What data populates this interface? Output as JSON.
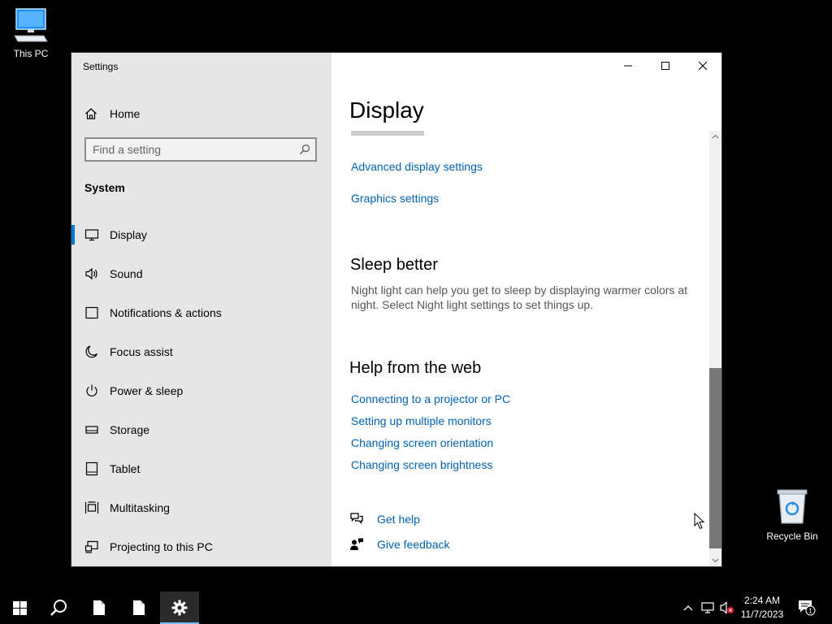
{
  "desktop": {
    "this_pc_label": "This PC",
    "recycle_bin_label": "Recycle Bin"
  },
  "window": {
    "title": "Settings",
    "home_label": "Home",
    "search_placeholder": "Find a setting",
    "section_label": "System",
    "nav_items": [
      {
        "label": "Display",
        "icon": "monitor-icon",
        "active": true
      },
      {
        "label": "Sound",
        "icon": "speaker-icon"
      },
      {
        "label": "Notifications & actions",
        "icon": "notification-icon"
      },
      {
        "label": "Focus assist",
        "icon": "moon-icon"
      },
      {
        "label": "Power & sleep",
        "icon": "power-icon"
      },
      {
        "label": "Storage",
        "icon": "storage-icon"
      },
      {
        "label": "Tablet",
        "icon": "tablet-icon"
      },
      {
        "label": "Multitasking",
        "icon": "multitasking-icon"
      },
      {
        "label": "Projecting to this PC",
        "icon": "projecting-icon"
      }
    ]
  },
  "content": {
    "page_title": "Display",
    "advanced_display_link": "Advanced display settings",
    "graphics_settings_link": "Graphics settings",
    "sleep_heading": "Sleep better",
    "sleep_text": "Night light can help you get to sleep by displaying warmer colors at night. Select Night light settings to set things up.",
    "help_heading": "Help from the web",
    "help_links": [
      "Connecting to a projector or PC",
      "Setting up multiple monitors",
      "Changing screen orientation",
      "Changing screen brightness"
    ],
    "get_help_label": "Get help",
    "give_feedback_label": "Give feedback"
  },
  "taskbar": {
    "time": "2:24 AM",
    "date": "11/7/2023",
    "notification_count": "1"
  },
  "colors": {
    "accent": "#0078d7",
    "link": "#0063b1",
    "sidebar_bg": "#e6e6e6"
  }
}
